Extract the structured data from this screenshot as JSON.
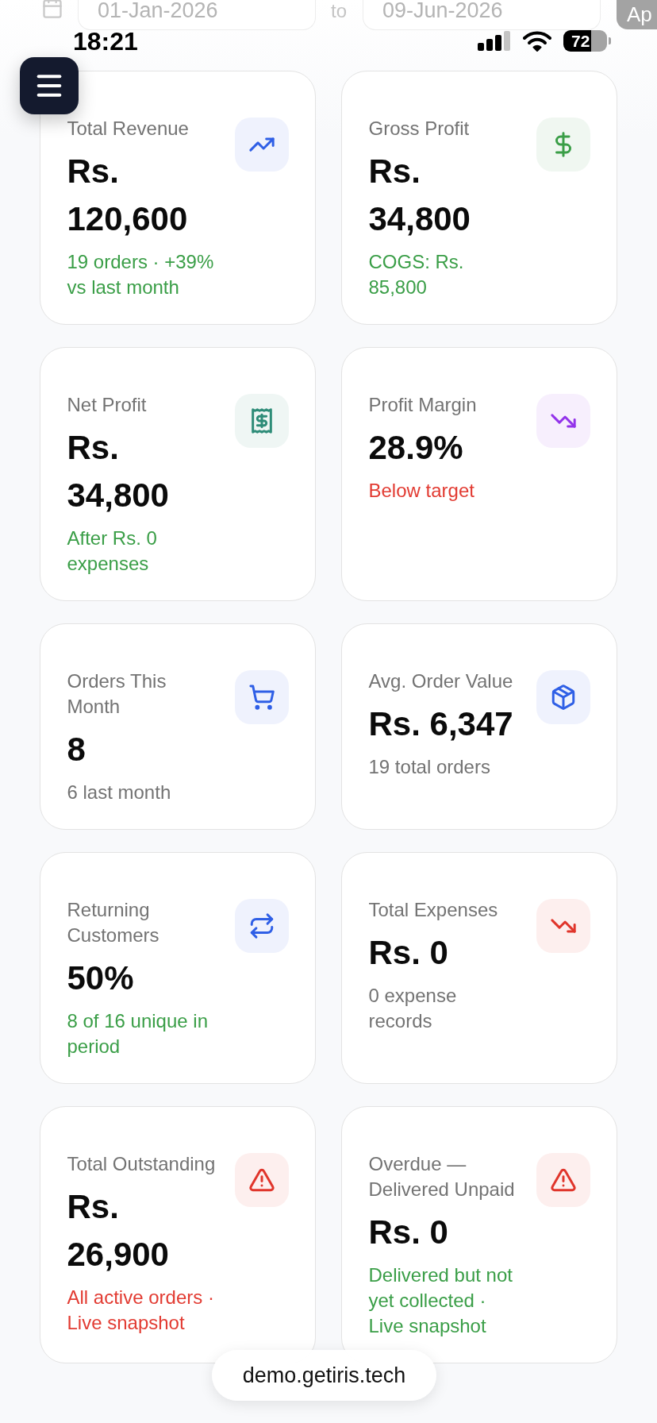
{
  "date_filter": {
    "start_date": "01-Jan-2026",
    "separator": "to",
    "end_date": "09-Jun-2026",
    "button": "Ap"
  },
  "status_bar": {
    "time": "18:21",
    "battery": "72"
  },
  "sections": [
    {
      "cards": [
        {
          "label": "Total Revenue",
          "value": "Rs. 120,600",
          "note": {
            "text": "19 orders · +39% vs last month",
            "color": "#3a9e47"
          },
          "color": "#2f5fe6"
        },
        {
          "label": "Gross Profit",
          "value": "Rs. 34,800",
          "note": {
            "text": "COGS: Rs. 85,800",
            "color": "#3a9e47"
          },
          "color": "#3a9e47"
        },
        {
          "label": "Net Profit",
          "value": "Rs. 34,800",
          "note": {
            "text": "After Rs. 0 expenses",
            "color": "#3a9e47"
          },
          "color": "#2e8c78"
        },
        {
          "label": "Profit Margin",
          "value": "28.9%",
          "note": {
            "text": "Below target",
            "color": "#e23b32"
          },
          "color": "#9333ea"
        }
      ]
    },
    {
      "cards": [
        {
          "label": "Orders This Month",
          "value": "8",
          "note": {
            "text": "6 last month",
            "color": "#737373"
          },
          "color": "#2f5fe6"
        },
        {
          "label": "Avg. Order Value",
          "value": "Rs. 6,347",
          "note": {
            "text": "19 total orders",
            "color": "#737373"
          },
          "color": "#2f5fe6"
        },
        {
          "label": "Returning Customers",
          "value": "50%",
          "note": {
            "text": "8 of 16 unique in period",
            "color": "#3a9e47"
          },
          "color": "#2f5fe6"
        },
        {
          "label": "Total Expenses",
          "value": "Rs. 0",
          "note": {
            "text": "0 expense records",
            "color": "#737373"
          },
          "color": "#e0352b"
        }
      ]
    },
    {
      "cards": [
        {
          "label": "Total Outstanding",
          "value": "Rs. 26,900",
          "note": {
            "text": "All active orders · Live snapshot",
            "color": "#e23b32"
          },
          "color": "#e0352b"
        },
        {
          "label": "Overdue — Delivered Unpaid",
          "value": "Rs. 0",
          "note": {
            "text": "Delivered but not yet collected · Live snapshot",
            "color": "#3a9e47"
          },
          "color": "#e0352b"
        }
      ]
    }
  ],
  "url_bar": {
    "address": "demo.getiris.tech"
  }
}
